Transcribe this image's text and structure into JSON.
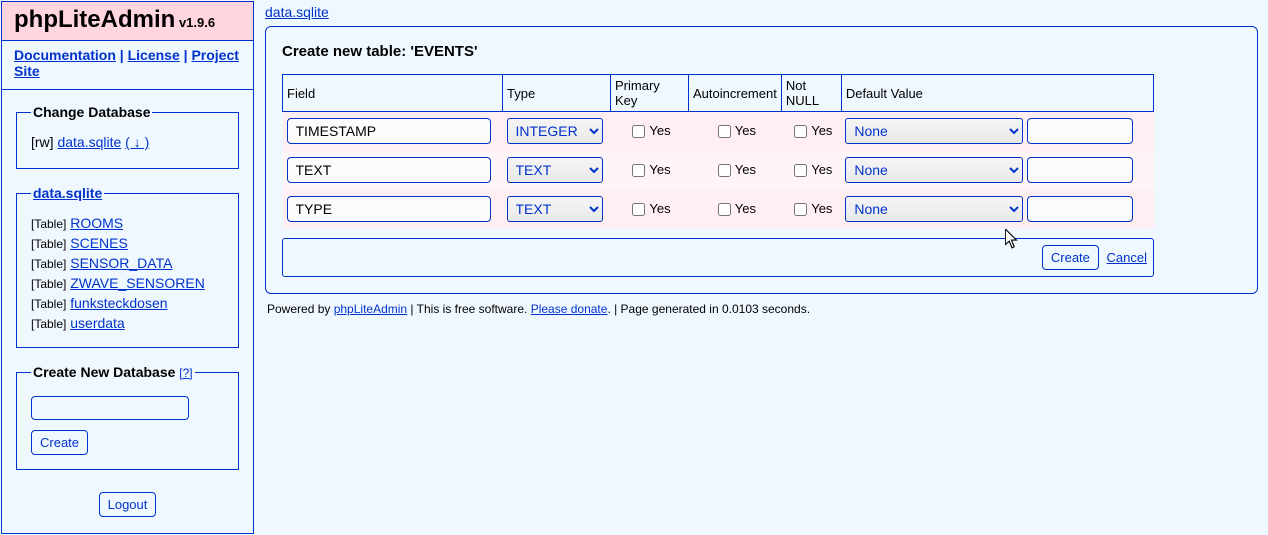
{
  "logo": {
    "title": "phpLiteAdmin",
    "version": "v1.9.6"
  },
  "nav": {
    "doc": "Documentation",
    "license": "License",
    "project": "Project Site"
  },
  "sidebar": {
    "change_db_legend": "Change Database",
    "rw": "[rw]",
    "db_name": "data.sqlite",
    "swap": "( ↓ )",
    "tables_legend": "data.sqlite",
    "tbl_prefix": "[Table]",
    "tables": [
      "ROOMS",
      "SCENES",
      "SENSOR_DATA",
      "ZWAVE_SENSOREN",
      "funksteckdosen",
      "userdata"
    ],
    "new_db_legend": "Create New Database",
    "help": "[?]",
    "create_btn": "Create",
    "logout": "Logout"
  },
  "breadcrumb": {
    "db": "data.sqlite"
  },
  "panel": {
    "title": "Create new table: 'EVENTS'",
    "headers": {
      "field": "Field",
      "type": "Type",
      "pk": "Primary Key",
      "ai": "Autoincrement",
      "nn": "Not NULL",
      "dv": "Default Value"
    },
    "yes": "Yes",
    "rows": [
      {
        "field": "TIMESTAMP",
        "type": "INTEGER",
        "pk": false,
        "ai": false,
        "nn": false,
        "dv": "None",
        "dvv": ""
      },
      {
        "field": "TEXT",
        "type": "TEXT",
        "pk": false,
        "ai": false,
        "nn": false,
        "dv": "None",
        "dvv": ""
      },
      {
        "field": "TYPE",
        "type": "TEXT",
        "pk": false,
        "ai": false,
        "nn": false,
        "dv": "None",
        "dvv": ""
      }
    ],
    "create": "Create",
    "cancel": "Cancel"
  },
  "footer": {
    "powered": "Powered by ",
    "pla": "phpLiteAdmin",
    "free": " | This is free software. ",
    "donate": "Please donate",
    "gen": ". | Page generated in 0.0103 seconds."
  }
}
